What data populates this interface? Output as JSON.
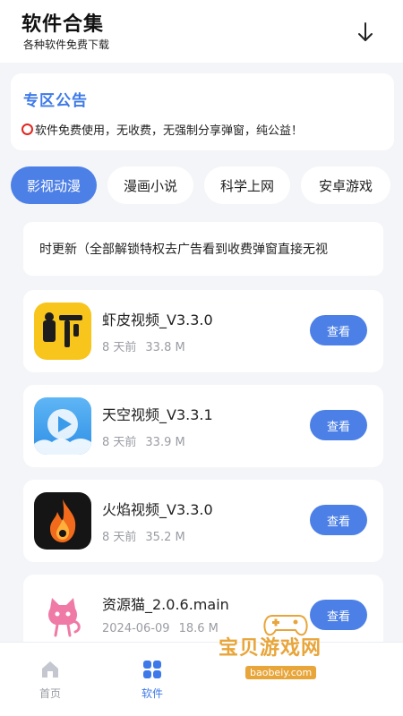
{
  "header": {
    "title": "软件合集",
    "subtitle": "各种软件免费下载"
  },
  "notice": {
    "title": "专区公告",
    "text": "软件免费使用，无收费，无强制分享弹窗，纯公益！"
  },
  "tabs": [
    {
      "label": "影视动漫",
      "active": true
    },
    {
      "label": "漫画小说",
      "active": false
    },
    {
      "label": "科学上网",
      "active": false
    },
    {
      "label": "安卓游戏",
      "active": false
    }
  ],
  "marquee": {
    "text": "时更新（全部解锁特权去广告看到收费弹窗直接无视"
  },
  "apps": [
    {
      "name": "虾皮视频_V3.3.0",
      "date": "8 天前",
      "size": "33.8 M",
      "button": "查看",
      "icon": "shrimp-video-icon"
    },
    {
      "name": "天空视频_V3.3.1",
      "date": "8 天前",
      "size": "33.9 M",
      "button": "查看",
      "icon": "sky-video-icon"
    },
    {
      "name": "火焰视频_V3.3.0",
      "date": "8 天前",
      "size": "35.2 M",
      "button": "查看",
      "icon": "flame-video-icon"
    },
    {
      "name": "资源猫_2.0.6.main",
      "date": "2024-06-09",
      "size": "18.6 M",
      "button": "查看",
      "icon": "resource-cat-icon"
    }
  ],
  "bottom_nav": [
    {
      "label": "首页",
      "icon": "home-icon",
      "active": false
    },
    {
      "label": "软件",
      "icon": "grid-icon",
      "active": true
    }
  ],
  "watermark": {
    "main": "宝贝游戏网",
    "sub": "baobeiy.com"
  },
  "colors": {
    "accent": "#4d80e6",
    "notice_title": "#3d79e8",
    "background": "#f4f5f8",
    "meta_text": "#9a9ca3"
  }
}
